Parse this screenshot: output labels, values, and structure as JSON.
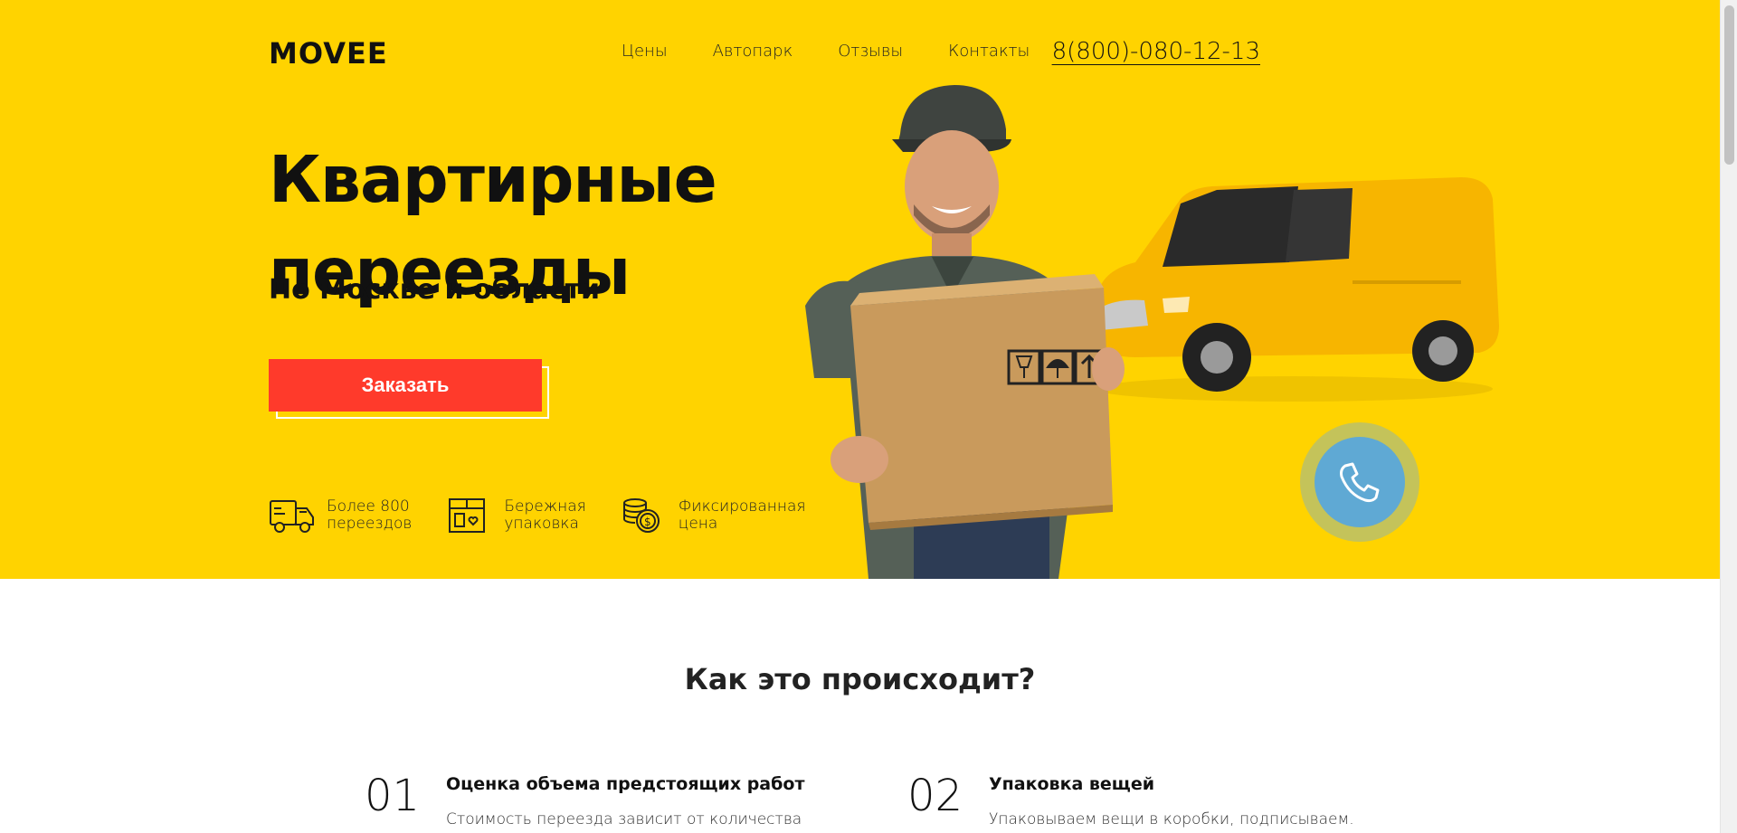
{
  "header": {
    "logo": "MOVEE",
    "nav": [
      "Цены",
      "Автопарк",
      "Отзывы",
      "Контакты"
    ],
    "phone": "8(800)-080-12-13"
  },
  "hero": {
    "title_line1": "Квартирные",
    "title_line2": "переезды",
    "subtitle": "По Москве и области",
    "cta_label": "Заказать",
    "features": [
      {
        "icon": "truck-icon",
        "line1": "Более 800",
        "line2": "переездов"
      },
      {
        "icon": "box-icon",
        "line1": "Бережная",
        "line2": "упаковка"
      },
      {
        "icon": "coins-icon",
        "line1": "Фиксированная",
        "line2": "цена"
      }
    ]
  },
  "how": {
    "title": "Как это происходит?",
    "steps": [
      {
        "num": "01",
        "title": "Оценка объема предстоящих работ",
        "desc": "Стоимость переезда зависит от количества"
      },
      {
        "num": "02",
        "title": "Упаковка вещей",
        "desc": "Упаковываем вещи в коробки, подписываем."
      }
    ]
  },
  "colors": {
    "accent": "#ffd300",
    "cta": "#ff3a2b",
    "call_button": "#5fa9d4"
  }
}
